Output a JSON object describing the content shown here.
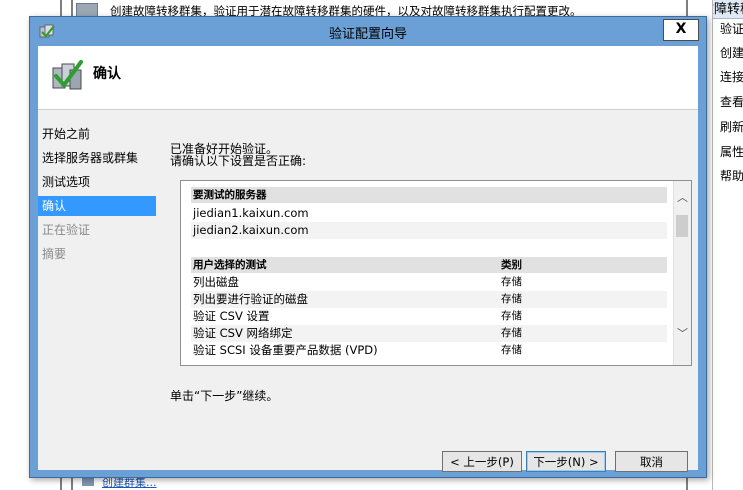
{
  "background": {
    "top_text": "创建故障转移群集，验证用于潜在故障转移群集的硬件，以及对故障转移群集执行配置更改。",
    "right_panel_header": "故障转移",
    "right_panel_items": [
      "验证",
      "创建",
      "连接",
      "查看",
      "刷新",
      "属性",
      "帮助"
    ],
    "bottom_link": "创建群集..."
  },
  "dialog": {
    "title": "验证配置向导",
    "close_glyph": "X",
    "header_title": "确认",
    "nav_items": [
      {
        "label": "开始之前",
        "state": "normal"
      },
      {
        "label": "选择服务器或群集",
        "state": "normal"
      },
      {
        "label": "测试选项",
        "state": "normal"
      },
      {
        "label": "确认",
        "state": "active"
      },
      {
        "label": "正在验证",
        "state": "disabled"
      },
      {
        "label": "摘要",
        "state": "disabled"
      }
    ],
    "intro_line1": "已准备好开始验证。",
    "intro_line2": "请确认以下设置是否正确:",
    "servers_header": "要测试的服务器",
    "servers": [
      "jiedian1.kaixun.com",
      "jiedian2.kaixun.com"
    ],
    "tests_header": "用户选择的测试",
    "category_header": "类别",
    "tests": [
      {
        "name": "列出磁盘",
        "category": "存储"
      },
      {
        "name": "列出要进行验证的磁盘",
        "category": "存储"
      },
      {
        "name": "验证 CSV 设置",
        "category": "存储"
      },
      {
        "name": "验证 CSV 网络绑定",
        "category": "存储"
      },
      {
        "name": "验证 SCSI 设备重要产品数据 (VPD)",
        "category": "存储"
      }
    ],
    "continue_text": "单击“下一步”继续。",
    "buttons": {
      "prev": "< 上一步(P)",
      "next": "下一步(N) >",
      "cancel": "取消"
    }
  }
}
